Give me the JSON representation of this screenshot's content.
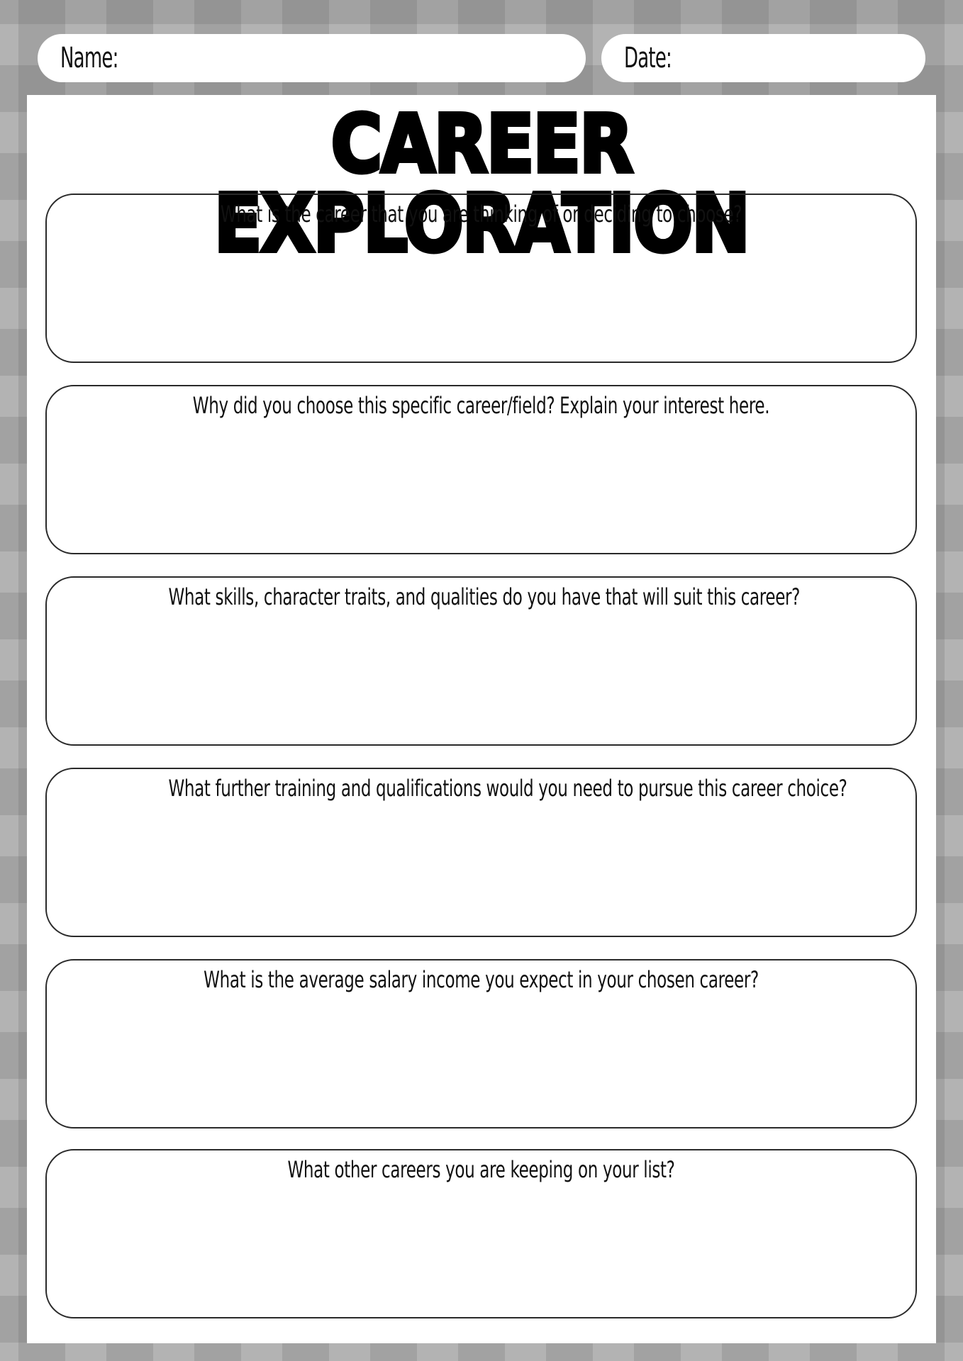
{
  "header": {
    "name_label": "Name:",
    "date_label": "Date:"
  },
  "title": "CAREER EXPLORATION",
  "questions": [
    {
      "text": "What is the career that you are thinking of or deciding to choose?",
      "answer": ""
    },
    {
      "text": "Why did you choose this specific career/field? Explain your interest here.",
      "answer": ""
    },
    {
      "text": "What skills, character traits, and qualities do you have that will suit this career?",
      "answer": ""
    },
    {
      "text": "What further training and qualifications would you need to pursue this career choice?",
      "answer": ""
    },
    {
      "text": "What is the average salary income you expect in your chosen career?",
      "answer": ""
    },
    {
      "text": "What other careers you are keeping on your list?",
      "answer": ""
    }
  ],
  "colors": {
    "background_light": "#b3b3b3",
    "background_dark": "#939393",
    "paper": "#ffffff",
    "ink": "#000000"
  }
}
